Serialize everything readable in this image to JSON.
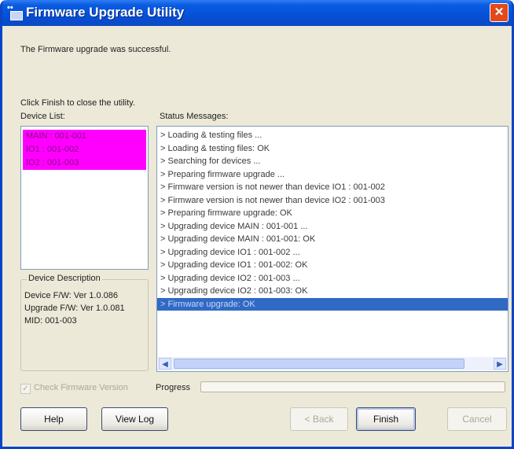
{
  "window": {
    "title": "Firmware Upgrade Utility",
    "close_glyph": "✕",
    "icon": "app-chip-icon"
  },
  "status_text": "The Firmware upgrade was successful.",
  "instruction_text": "Click Finish to close the utility.",
  "device_list": {
    "label": "Device List:",
    "items": [
      "MAIN : 001-001",
      "IO1 : 001-002",
      "IO2 : 001-003"
    ],
    "highlight_color": "#ff00ff"
  },
  "device_description": {
    "title": "Device Description",
    "lines": [
      "Device F/W: Ver 1.0.086",
      "Upgrade F/W: Ver 1.0.081",
      "MID: 001-003"
    ]
  },
  "status_messages": {
    "label": "Status Messages:",
    "items": [
      "> Loading & testing files ...",
      "> Loading & testing files: OK",
      "> Searching for devices ...",
      "> Preparing firmware upgrade ...",
      "> Firmware version is not newer than device IO1 : 001-002",
      "> Firmware version is not newer than device IO2 : 001-003",
      "> Preparing firmware upgrade: OK",
      "> Upgrading device MAIN : 001-001 ...",
      "> Upgrading device MAIN : 001-001: OK",
      "> Upgrading device IO1 : 001-002 ...",
      "> Upgrading device IO1 : 001-002: OK",
      "> Upgrading device IO2 : 001-003 ...",
      "> Upgrading device IO2 : 001-003: OK",
      "> Firmware upgrade: OK"
    ],
    "selected_index": 13,
    "selected_color": "#316ac5"
  },
  "check_newer": {
    "label": "Check Firmware Version",
    "checked": true
  },
  "progress": {
    "label": "Progress",
    "value": 0
  },
  "buttons": {
    "help": "Help",
    "view_log": "View Log",
    "back": "< Back",
    "finish": "Finish",
    "cancel": "Cancel"
  },
  "scroll_arrows": {
    "left": "◀",
    "right": "▶"
  }
}
